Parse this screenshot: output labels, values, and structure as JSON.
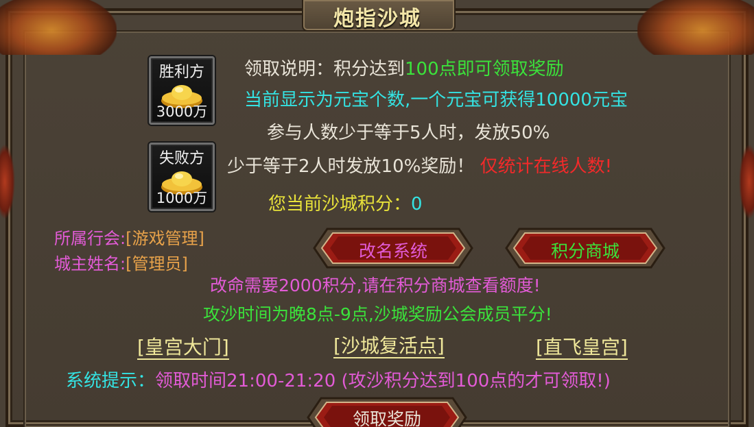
{
  "window": {
    "title": "炮指沙城"
  },
  "rewards": [
    {
      "label": "胜利方",
      "amount": "3000万"
    },
    {
      "label": "失败方",
      "amount": "1000万"
    }
  ],
  "info": {
    "line1_prefix": "领取说明：积分达到",
    "line1_highlight": "100点即可领取奖励",
    "line2": "当前显示为元宝个数,一个元宝可获得10000元宝",
    "line3": "参与人数少于等于5人时，发放50%",
    "line4_prefix": "少于等于2人时发放10%奖励！",
    "line4_warning": "仅统计在线人数!",
    "score_label": "您当前沙城积分：",
    "score_value": "0"
  },
  "guild": {
    "guild_label": "所属行会:",
    "guild_value": "[游戏管理]",
    "owner_label": "城主姓名:",
    "owner_value": "[管理员]"
  },
  "buttons": {
    "rename": "改名系统",
    "shop": "积分商城",
    "claim": "领取奖励"
  },
  "notices": {
    "rename_cost": "改命需要2000积分,请在积分商城查看额度!",
    "siege_time": "攻沙时间为晚8点-9点,沙城奖励公会成员平分!"
  },
  "links": {
    "palace_gate": "[皇宫大门]",
    "revive_point": "[沙城复活点]",
    "fly_palace": "[直飞皇宫]"
  },
  "system_tip": {
    "label": "系统提示：",
    "text": "领取时间21:00-21:20 (攻沙积分达到100点的才可领取!)"
  }
}
